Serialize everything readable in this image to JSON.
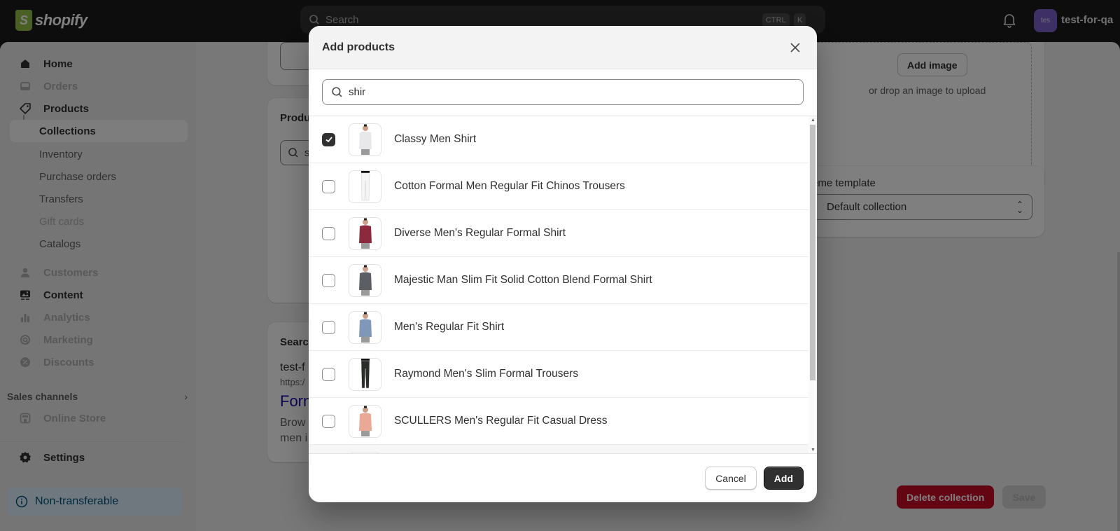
{
  "topbar": {
    "logo_text": "shopify",
    "search_placeholder": "Search",
    "shortcut_keys": [
      "CTRL",
      "K"
    ],
    "avatar_initials": "tes",
    "store_name": "test-for-qa"
  },
  "sidebar": {
    "items": [
      {
        "label": "Home",
        "icon": "home-icon"
      },
      {
        "label": "Orders",
        "icon": "inbox-icon"
      },
      {
        "label": "Products",
        "icon": "tag-icon"
      },
      {
        "label": "Collections"
      },
      {
        "label": "Inventory"
      },
      {
        "label": "Purchase orders"
      },
      {
        "label": "Transfers"
      },
      {
        "label": "Gift cards"
      },
      {
        "label": "Catalogs"
      },
      {
        "label": "Customers",
        "icon": "person-icon"
      },
      {
        "label": "Content",
        "icon": "content-icon"
      },
      {
        "label": "Analytics",
        "icon": "bar-chart-icon"
      },
      {
        "label": "Marketing",
        "icon": "target-icon"
      },
      {
        "label": "Discounts",
        "icon": "discount-icon"
      }
    ],
    "sales_channels_label": "Sales channels",
    "online_store_label": "Online Store",
    "settings_label": "Settings",
    "non_transferable_label": "Non-transferable"
  },
  "main": {
    "products_card_title": "Produ",
    "products_search_value": "s",
    "seo_card_title": "Searc",
    "seo_store": "test-f",
    "seo_url": "https:/",
    "seo_title": "Forn",
    "seo_desc_line1": "Brow",
    "seo_desc_line2": "men i",
    "add_image_label": "Add image",
    "drop_image_label": "or drop an image to upload",
    "theme_template_label": "eme template",
    "theme_template_value": "Default collection",
    "delete_collection_label": "Delete collection",
    "save_label": "Save"
  },
  "modal": {
    "title": "Add products",
    "search_value": "shir",
    "products": [
      {
        "name": "Classy Men Shirt",
        "checked": true,
        "color": "#e8e8ea"
      },
      {
        "name": "Cotton Formal Men Regular Fit Chinos Trousers",
        "checked": false,
        "color": "#f5f5f5"
      },
      {
        "name": "Diverse Men's Regular Formal Shirt",
        "checked": false,
        "color": "#8b2a3c"
      },
      {
        "name": "Majestic Man Slim Fit Solid Cotton Blend Formal Shirt",
        "checked": false,
        "color": "#5b5e62"
      },
      {
        "name": "Men's Regular Fit Shirt",
        "checked": false,
        "color": "#7f97b8"
      },
      {
        "name": "Raymond Men's Slim Formal Trousers",
        "checked": false,
        "color": "#2a2c2a"
      },
      {
        "name": "SCULLERS Men's Regular Fit Casual Dress",
        "checked": false,
        "color": "#eaa994"
      }
    ],
    "cancel_label": "Cancel",
    "add_label": "Add"
  },
  "colors": {
    "primary_button": "#303030",
    "danger": "#c70a24",
    "link": "#1a0dab",
    "avatar": "#7c60c9"
  }
}
